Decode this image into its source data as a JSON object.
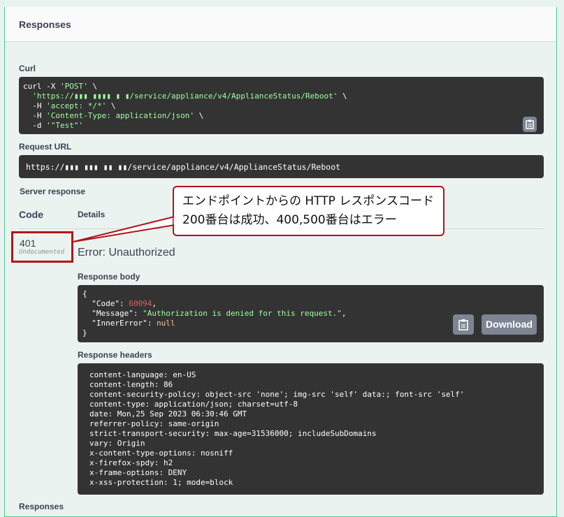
{
  "responses_title": "Responses",
  "curl": {
    "label": "Curl",
    "line1": "curl -X ",
    "method": "'POST'",
    "line1_tail": " \\",
    "url_prefix": "'https://",
    "url_redacted": "▮▮▮ ▮▮▮▮ ▮ ▮",
    "url_path": "/service/appliance/v4/ApplianceStatus/Reboot'",
    "url_tail": " \\",
    "h1_pre": "  -H ",
    "h1": "'accept: */*'",
    "h1_tail": " \\",
    "h2_pre": "  -H ",
    "h2": "'Content-Type: application/json'",
    "h2_tail": " \\",
    "d_pre": "  -d ",
    "d": "'\"Test\"'"
  },
  "request_url": {
    "label": "Request URL",
    "prefix": "https://",
    "redacted": "▮▮▮ ▮▮▮ ▮▮ ▮▮",
    "path": "/service/appliance/v4/ApplianceStatus/Reboot"
  },
  "server_response_label": "Server response",
  "columns": {
    "code": "Code",
    "details": "Details"
  },
  "status": {
    "code": "401",
    "documented": "Undocumented",
    "error_text": "Error: Unauthorized"
  },
  "response_body": {
    "label": "Response body",
    "code_key": "\"Code\"",
    "code_val": "60094",
    "message_key": "\"Message\"",
    "message_val": "\"Authorization is denied for this request.\"",
    "inner_key": "\"InnerError\"",
    "inner_val": "null",
    "download": "Download"
  },
  "response_headers": {
    "label": "Response headers",
    "lines": [
      "content-language: en-US",
      "content-length: 86",
      "content-security-policy: object-src 'none'; img-src 'self' data:; font-src 'self'",
      "content-type: application/json; charset=utf-8",
      "date: Mon,25 Sep 2023 06:30:46 GMT",
      "referrer-policy: same-origin",
      "strict-transport-security: max-age=31536000; includeSubDomains",
      "vary: Origin",
      "x-content-type-options: nosniff",
      "x-firefox-spdy: h2",
      "x-frame-options: DENY",
      "x-xss-protection: 1; mode=block"
    ]
  },
  "bottom_label": "Responses",
  "callout": {
    "line1": "エンドポイントからの HTTP レスポンスコード",
    "line2": "200番台は成功、400,500番台はエラー"
  },
  "colors": {
    "accent": "#49cc90",
    "code_bg": "#333333",
    "callout_border": "#b0141c"
  }
}
